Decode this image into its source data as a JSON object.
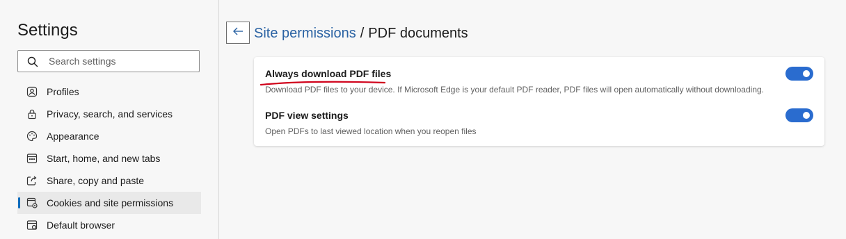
{
  "sidebar": {
    "title": "Settings",
    "search_placeholder": "Search settings",
    "items": [
      {
        "label": "Profiles",
        "icon": "profile-icon"
      },
      {
        "label": "Privacy, search, and services",
        "icon": "lock-icon"
      },
      {
        "label": "Appearance",
        "icon": "palette-icon"
      },
      {
        "label": "Start, home, and new tabs",
        "icon": "tabs-icon"
      },
      {
        "label": "Share, copy and paste",
        "icon": "share-icon"
      },
      {
        "label": "Cookies and site permissions",
        "icon": "cookies-settings-icon",
        "selected": true
      },
      {
        "label": "Default browser",
        "icon": "browser-icon"
      }
    ]
  },
  "header": {
    "breadcrumb_parent": "Site permissions",
    "separator": "/",
    "current": "PDF documents"
  },
  "settings": [
    {
      "title": "Always download PDF files",
      "description": "Download PDF files to your device. If Microsoft Edge is your default PDF reader, PDF files will open automatically without downloading.",
      "enabled": true
    },
    {
      "title": "PDF view settings",
      "description": "Open PDFs to last viewed location when you reopen files",
      "enabled": true
    }
  ],
  "colors": {
    "accent": "#2a6ccf",
    "link": "#2a62a3",
    "annotation": "#d0021b"
  }
}
